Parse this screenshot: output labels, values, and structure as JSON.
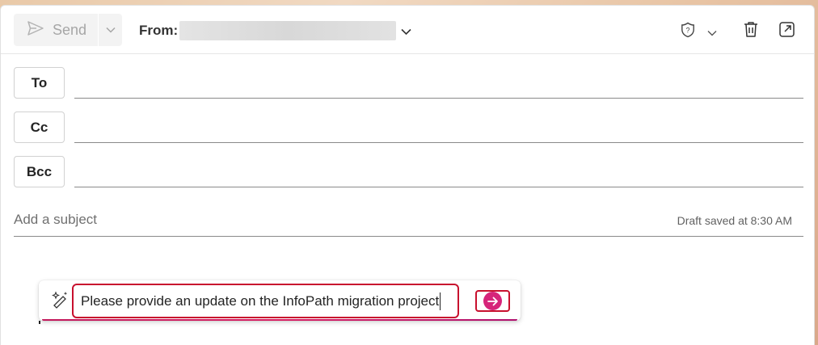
{
  "toolbar": {
    "send_label": "Send",
    "from_label": "From:",
    "from_value": ""
  },
  "recipients": {
    "to_label": "To",
    "cc_label": "Cc",
    "bcc_label": "Bcc"
  },
  "subject": {
    "placeholder": "Add a subject",
    "draft_status": "Draft saved at 8:30 AM"
  },
  "copilot": {
    "prompt_value": "Please provide an update on the InfoPath migration project"
  },
  "colors": {
    "accent": "#c8102e",
    "copilot_button": "#d6247a"
  },
  "icons": [
    "send-icon",
    "chevron-down-icon",
    "sensitivity-shield-icon",
    "trash-icon",
    "pop-out-icon",
    "copilot-wand-icon",
    "arrow-right-icon"
  ]
}
